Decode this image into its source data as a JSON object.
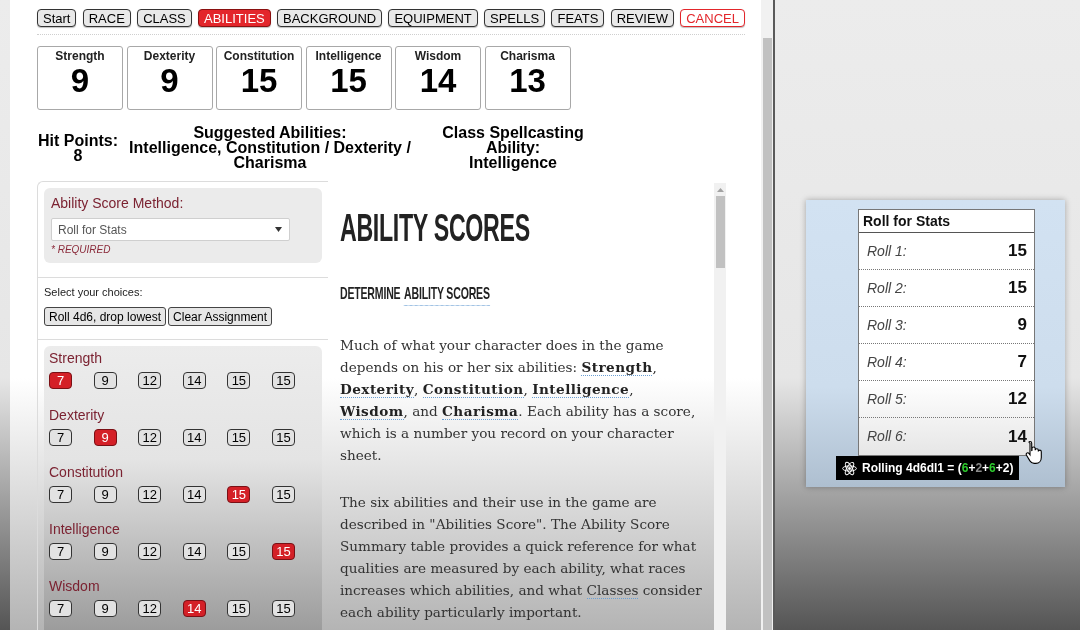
{
  "nav": [
    {
      "label": "Start",
      "kind": "step",
      "selected": false
    },
    {
      "label": "RACE",
      "kind": "step",
      "selected": false
    },
    {
      "label": "CLASS",
      "kind": "step",
      "selected": false
    },
    {
      "label": "ABILITIES",
      "kind": "step",
      "selected": true
    },
    {
      "label": "BACKGROUND",
      "kind": "step",
      "selected": false
    },
    {
      "label": "EQUIPMENT",
      "kind": "step",
      "selected": false
    },
    {
      "label": "SPELLS",
      "kind": "step",
      "selected": false
    },
    {
      "label": "FEATS",
      "kind": "step",
      "selected": false
    },
    {
      "label": "REVIEW",
      "kind": "step",
      "selected": false
    },
    {
      "label": "CANCEL",
      "kind": "cancel",
      "selected": false
    }
  ],
  "ability_scores": [
    {
      "name": "Strength",
      "score": "9"
    },
    {
      "name": "Dexterity",
      "score": "9"
    },
    {
      "name": "Constitution",
      "score": "15"
    },
    {
      "name": "Intelligence",
      "score": "15"
    },
    {
      "name": "Wisdom",
      "score": "14"
    },
    {
      "name": "Charisma",
      "score": "13"
    }
  ],
  "hit_points": {
    "label": "Hit Points:",
    "value": "8"
  },
  "suggested_abilities": {
    "label": "Suggested Abilities:",
    "value": "Intelligence, Constitution / Dexterity / Charisma"
  },
  "spellcasting_ability": {
    "label": "Class Spellcasting Ability:",
    "value": "Intelligence"
  },
  "method": {
    "label": "Ability Score Method:",
    "value": "Roll for Stats",
    "note": "* REQUIRED"
  },
  "choices": {
    "label": "Select your choices:",
    "buttons": [
      "Roll 4d6, drop lowest",
      "Clear Assignment"
    ]
  },
  "assignments": [
    {
      "name": "Strength",
      "options": [
        {
          "value": "7",
          "selected": true
        },
        {
          "value": "9",
          "selected": false
        },
        {
          "value": "12",
          "selected": false
        },
        {
          "value": "14",
          "selected": false
        },
        {
          "value": "15",
          "selected": false
        },
        {
          "value": "15",
          "selected": false
        }
      ]
    },
    {
      "name": "Dexterity",
      "options": [
        {
          "value": "7",
          "selected": false
        },
        {
          "value": "9",
          "selected": true
        },
        {
          "value": "12",
          "selected": false
        },
        {
          "value": "14",
          "selected": false
        },
        {
          "value": "15",
          "selected": false
        },
        {
          "value": "15",
          "selected": false
        }
      ]
    },
    {
      "name": "Constitution",
      "options": [
        {
          "value": "7",
          "selected": false
        },
        {
          "value": "9",
          "selected": false
        },
        {
          "value": "12",
          "selected": false
        },
        {
          "value": "14",
          "selected": false
        },
        {
          "value": "15",
          "selected": true
        },
        {
          "value": "15",
          "selected": false
        }
      ]
    },
    {
      "name": "Intelligence",
      "options": [
        {
          "value": "7",
          "selected": false
        },
        {
          "value": "9",
          "selected": false
        },
        {
          "value": "12",
          "selected": false
        },
        {
          "value": "14",
          "selected": false
        },
        {
          "value": "15",
          "selected": false
        },
        {
          "value": "15",
          "selected": true
        }
      ]
    },
    {
      "name": "Wisdom",
      "options": [
        {
          "value": "7",
          "selected": false
        },
        {
          "value": "9",
          "selected": false
        },
        {
          "value": "12",
          "selected": false
        },
        {
          "value": "14",
          "selected": true
        },
        {
          "value": "15",
          "selected": false
        },
        {
          "value": "15",
          "selected": false
        }
      ]
    }
  ],
  "article": {
    "title": "ABILITY SCORES",
    "subheading": {
      "text": "DETERMINE",
      "link": "ABILITY SCORES"
    },
    "paragraphs": [
      [
        {
          "text": "Much of what your character does in the game depends on his or her six abilities: ",
          "kind": "text"
        },
        {
          "text": "Strength",
          "kind": "term"
        },
        {
          "text": ", ",
          "kind": "text"
        },
        {
          "text": "Dexterity",
          "kind": "term"
        },
        {
          "text": ", ",
          "kind": "text"
        },
        {
          "text": "Constitution",
          "kind": "term"
        },
        {
          "text": ", ",
          "kind": "text"
        },
        {
          "text": "Intelligence",
          "kind": "term"
        },
        {
          "text": ", ",
          "kind": "text"
        },
        {
          "text": "Wisdom",
          "kind": "term"
        },
        {
          "text": ", and ",
          "kind": "text"
        },
        {
          "text": "Charisma",
          "kind": "term"
        },
        {
          "text": ". Each ability has a score, which is a number you record on your character sheet.",
          "kind": "text"
        }
      ],
      [
        {
          "text": "The six abilities and their use in the game are described in \"Abilities Score\". The Ability Score Summary table provides a quick reference for what qualities are measured by each ability, what races increases which abilities, and what ",
          "kind": "text"
        },
        {
          "text": "Classes",
          "kind": "link"
        },
        {
          "text": " consider each ability particularly important.",
          "kind": "text"
        }
      ]
    ]
  },
  "roll_panel": {
    "title": "Roll for Stats",
    "rolls": [
      {
        "label": "Roll 1:",
        "value": "15"
      },
      {
        "label": "Roll 2:",
        "value": "15"
      },
      {
        "label": "Roll 3:",
        "value": "9"
      },
      {
        "label": "Roll 4:",
        "value": "7"
      },
      {
        "label": "Roll 5:",
        "value": "12"
      },
      {
        "label": "Roll 6:",
        "value": "14"
      }
    ],
    "tooltip": {
      "prefix": "Rolling 4d6dl1 = (",
      "dice": [
        {
          "value": "6",
          "kind": "max"
        },
        {
          "value": "2",
          "kind": "dropped"
        },
        {
          "value": "6",
          "kind": "max"
        },
        {
          "value": "2",
          "kind": "kept"
        }
      ],
      "joiner": "+",
      "suffix": ")"
    }
  }
}
